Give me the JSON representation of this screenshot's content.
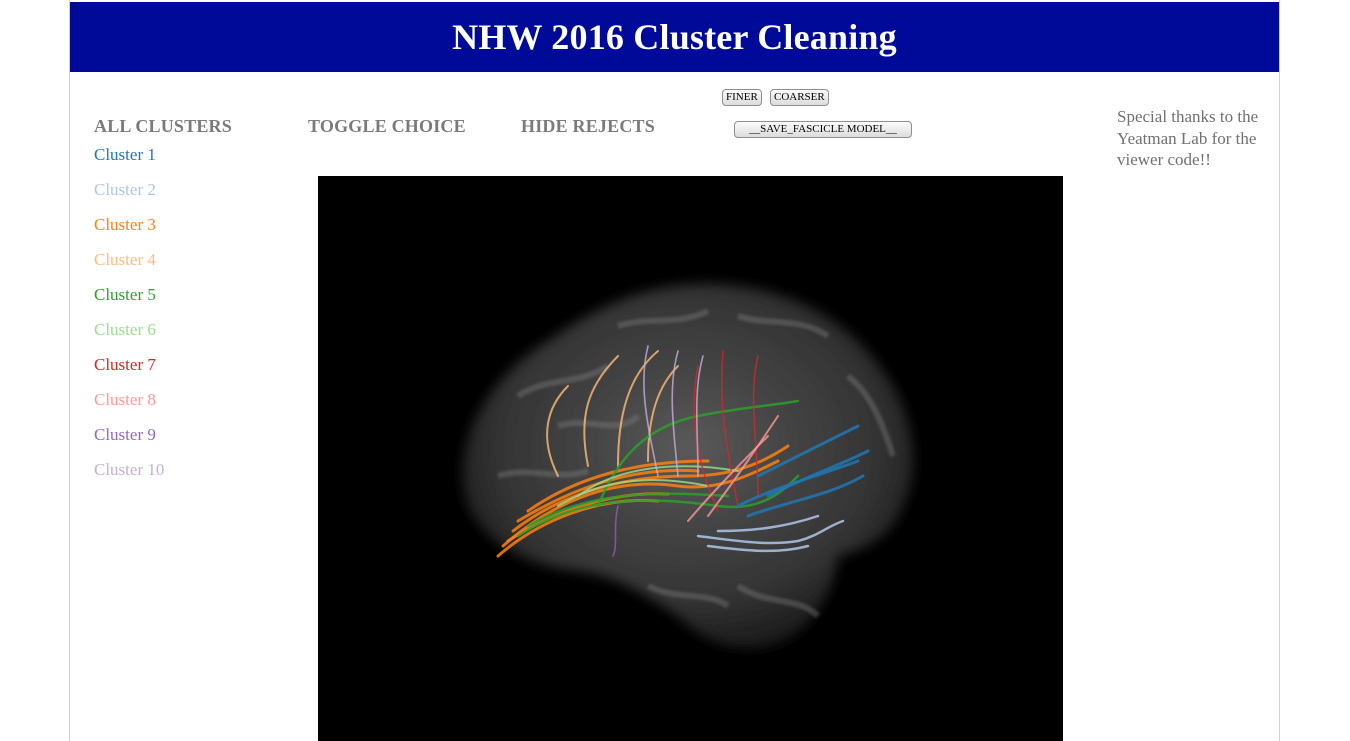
{
  "header": {
    "title": "NHW 2016 Cluster Cleaning"
  },
  "menu": {
    "all_clusters": "ALL CLUSTERS",
    "toggle_choice": "TOGGLE CHOICE",
    "hide_rejects": "HIDE REJECTS"
  },
  "buttons": {
    "finer": "FINER",
    "coarser": "COARSER",
    "save": "__SAVE_FASCICLE MODEL__"
  },
  "clusters": [
    {
      "label": "Cluster 1",
      "color": "#1f77b4"
    },
    {
      "label": "Cluster 2",
      "color": "#aec7e8"
    },
    {
      "label": "Cluster 3",
      "color": "#ff7f0e"
    },
    {
      "label": "Cluster 4",
      "color": "#ffbb78"
    },
    {
      "label": "Cluster 5",
      "color": "#2ca02c"
    },
    {
      "label": "Cluster 6",
      "color": "#98df8a"
    },
    {
      "label": "Cluster 7",
      "color": "#d62728"
    },
    {
      "label": "Cluster 8",
      "color": "#ff9896"
    },
    {
      "label": "Cluster 9",
      "color": "#9467bd"
    },
    {
      "label": "Cluster 10",
      "color": "#c5b0d5"
    }
  ],
  "sidebar": {
    "thanks": "Special thanks to the Yeatman Lab for the viewer code!!"
  },
  "colors": {
    "header_bg": "#000a99",
    "viewer_bg": "#000000",
    "menu_text": "#7a7a7a"
  }
}
